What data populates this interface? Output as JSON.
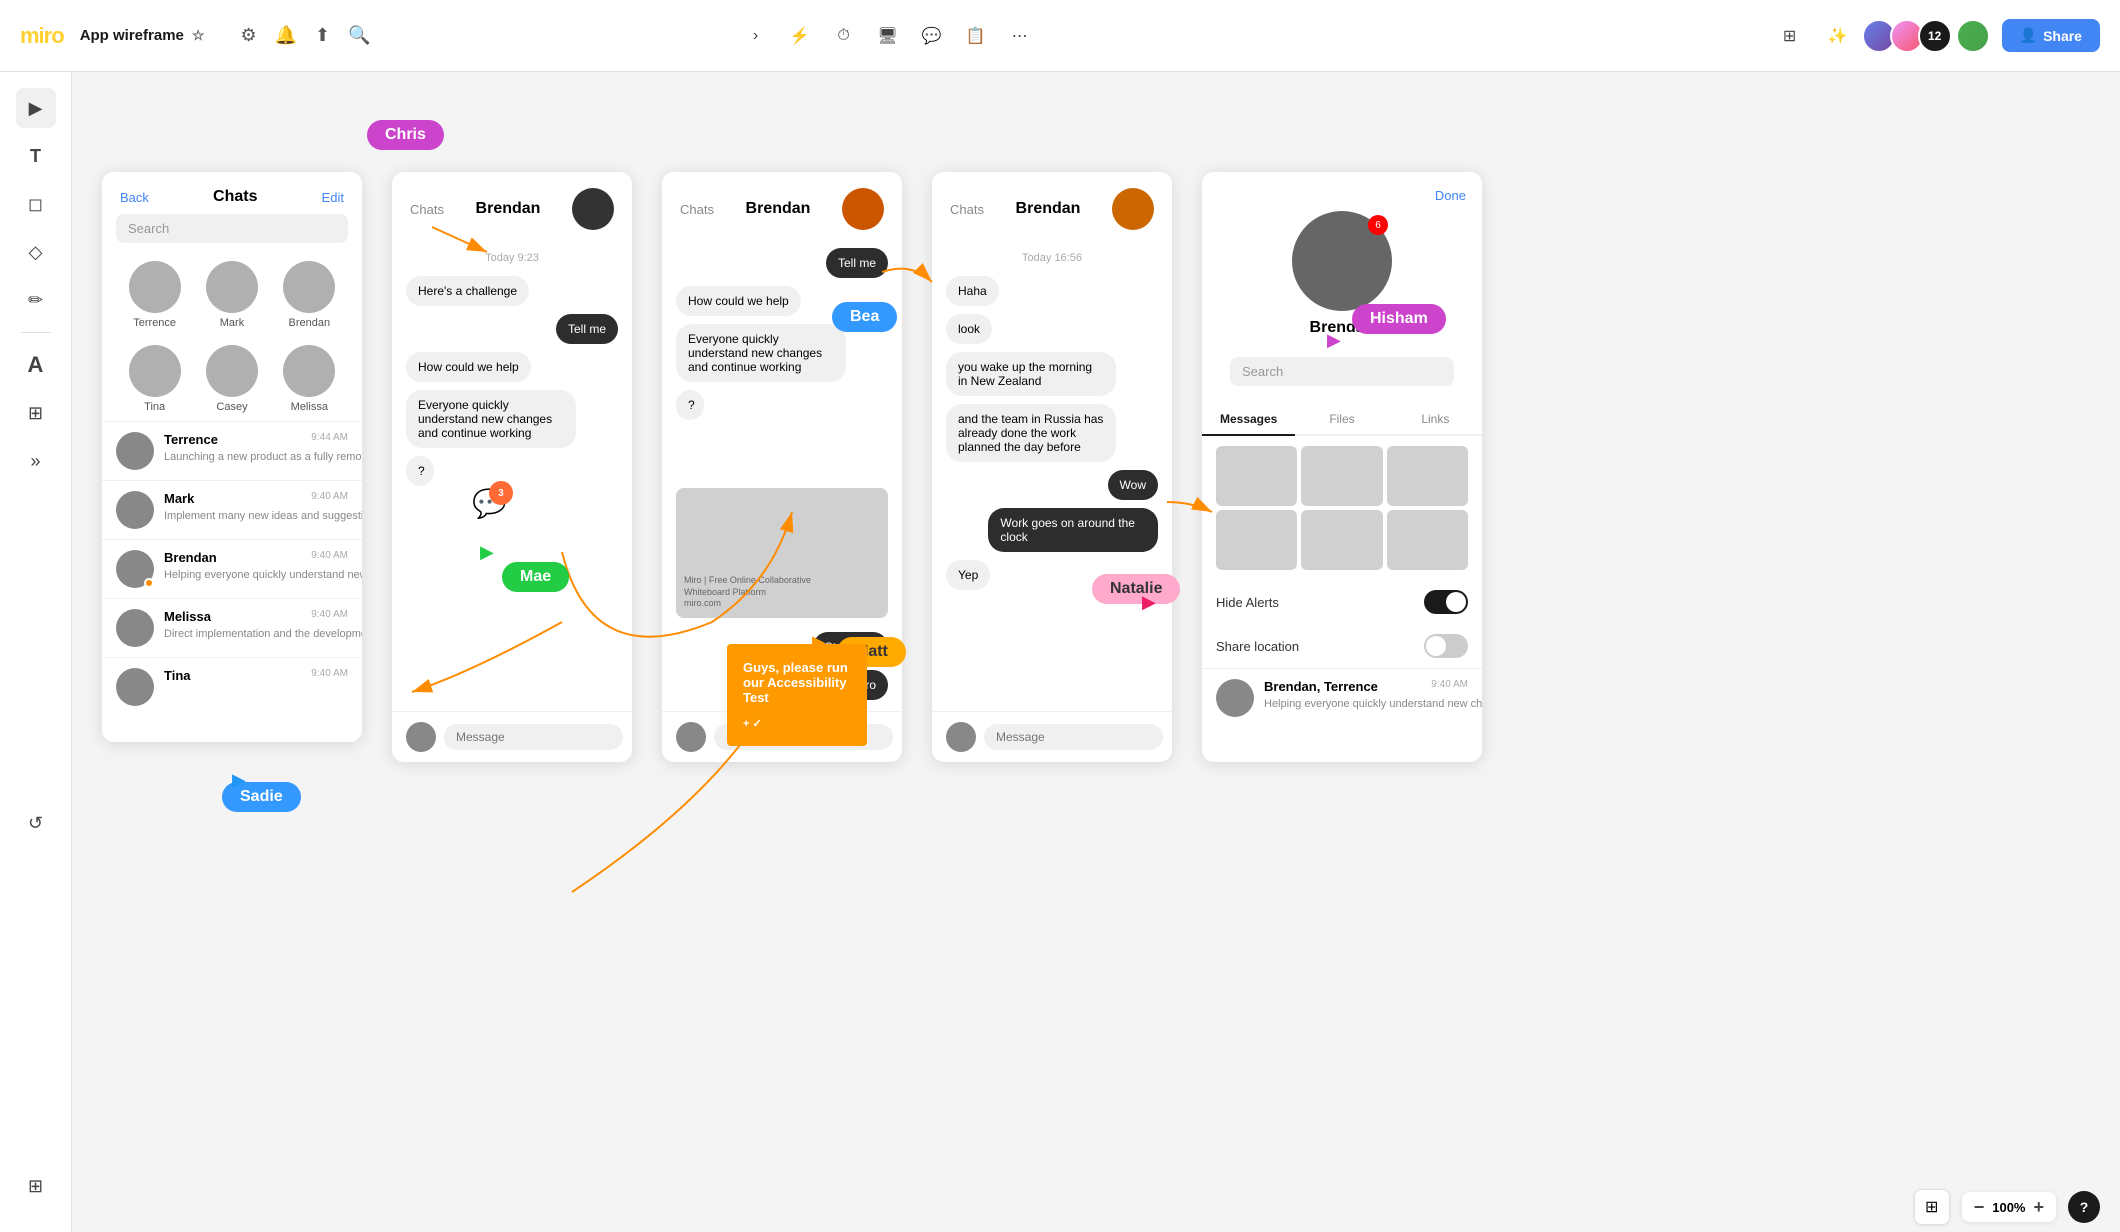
{
  "toolbar": {
    "logo": "miro",
    "title": "App wireframe",
    "share_label": "Share",
    "avatar_count": "12"
  },
  "panels": {
    "panel1": {
      "header_back": "Back",
      "header_title": "Chats",
      "header_edit": "Edit",
      "search_placeholder": "Search",
      "avatars": [
        {
          "name": "Terrence"
        },
        {
          "name": "Mark"
        },
        {
          "name": "Brendan"
        },
        {
          "name": "Tina"
        },
        {
          "name": "Casey"
        },
        {
          "name": "Melissa"
        }
      ],
      "chat_items": [
        {
          "name": "Terrence",
          "time": "9:44 AM",
          "preview": "Launching a new product as a fully remote team required an easy way...",
          "dot": false
        },
        {
          "name": "Mark",
          "time": "9:40 AM",
          "preview": "Implement many new ideas and suggestions from the team",
          "dot": false
        },
        {
          "name": "Brendan",
          "time": "9:40 AM",
          "preview": "Helping everyone quickly understand new changes and continue working",
          "dot": true
        },
        {
          "name": "Melissa",
          "time": "9:40 AM",
          "preview": "Direct implementation and the development of a minimum viable prod...",
          "dot": false
        },
        {
          "name": "Tina",
          "time": "9:40 AM",
          "preview": "",
          "dot": false
        }
      ]
    },
    "panel2": {
      "header_chats": "Chats",
      "header_name": "Brendan",
      "date": "Today 9:23",
      "messages": [
        {
          "text": "Here's a challenge",
          "type": "received"
        },
        {
          "text": "Tell me",
          "type": "sent"
        },
        {
          "text": "How could we help",
          "type": "received"
        },
        {
          "text": "Everyone quickly understand new changes and continue working",
          "type": "received"
        },
        {
          "text": "?",
          "type": "received"
        }
      ],
      "input_placeholder": "Message"
    },
    "panel3": {
      "header_chats": "Chats",
      "header_name": "Brendan",
      "messages": [
        {
          "text": "Tell me",
          "type": "sent"
        },
        {
          "text": "How could we help",
          "type": "received"
        },
        {
          "text": "Everyone quickly understand new changes and continue working",
          "type": "received"
        },
        {
          "text": "?",
          "type": "received"
        },
        {
          "text": "Startup in",
          "type": "sent"
        },
        {
          "text": "Miro",
          "type": "sent"
        }
      ],
      "input_placeholder": "Message"
    },
    "panel4": {
      "header_chats": "Chats",
      "header_name": "Brendan",
      "date": "Today 16:56",
      "messages": [
        {
          "text": "Haha",
          "type": "received"
        },
        {
          "text": "look",
          "type": "received"
        },
        {
          "text": "you wake up the morning in New Zealand",
          "type": "received"
        },
        {
          "text": "and the team in Russia has already done the work planned the day before",
          "type": "received"
        },
        {
          "text": "Wow",
          "type": "sent"
        },
        {
          "text": "Work goes on around the clock",
          "type": "sent"
        },
        {
          "text": "Yep",
          "type": "received"
        }
      ],
      "input_placeholder": "Message"
    },
    "panel5": {
      "header_done": "Done",
      "profile_name": "Brendan",
      "badge_count": "6",
      "tabs": [
        "Messages",
        "Files",
        "Links"
      ],
      "toggle_alerts": "Hide Alerts",
      "toggle_location": "Share location",
      "recent_chat_name": "Brendan, Terrence",
      "recent_chat_time": "9:40 AM",
      "recent_chat_preview": "Helping everyone quickly understand new changes and continue working",
      "search_placeholder": "Search"
    }
  },
  "labels": {
    "chris": "Chris",
    "mae": "Mae",
    "bea": "Bea",
    "matt": "Matt",
    "hisham": "Hisham",
    "natalie": "Natalie",
    "sadie": "Sadie"
  },
  "sticky": {
    "text": "Guys, please run our Accessibility Test",
    "icon": "+ ✓"
  },
  "zoom": {
    "level": "100%",
    "minus": "−",
    "plus": "+"
  }
}
